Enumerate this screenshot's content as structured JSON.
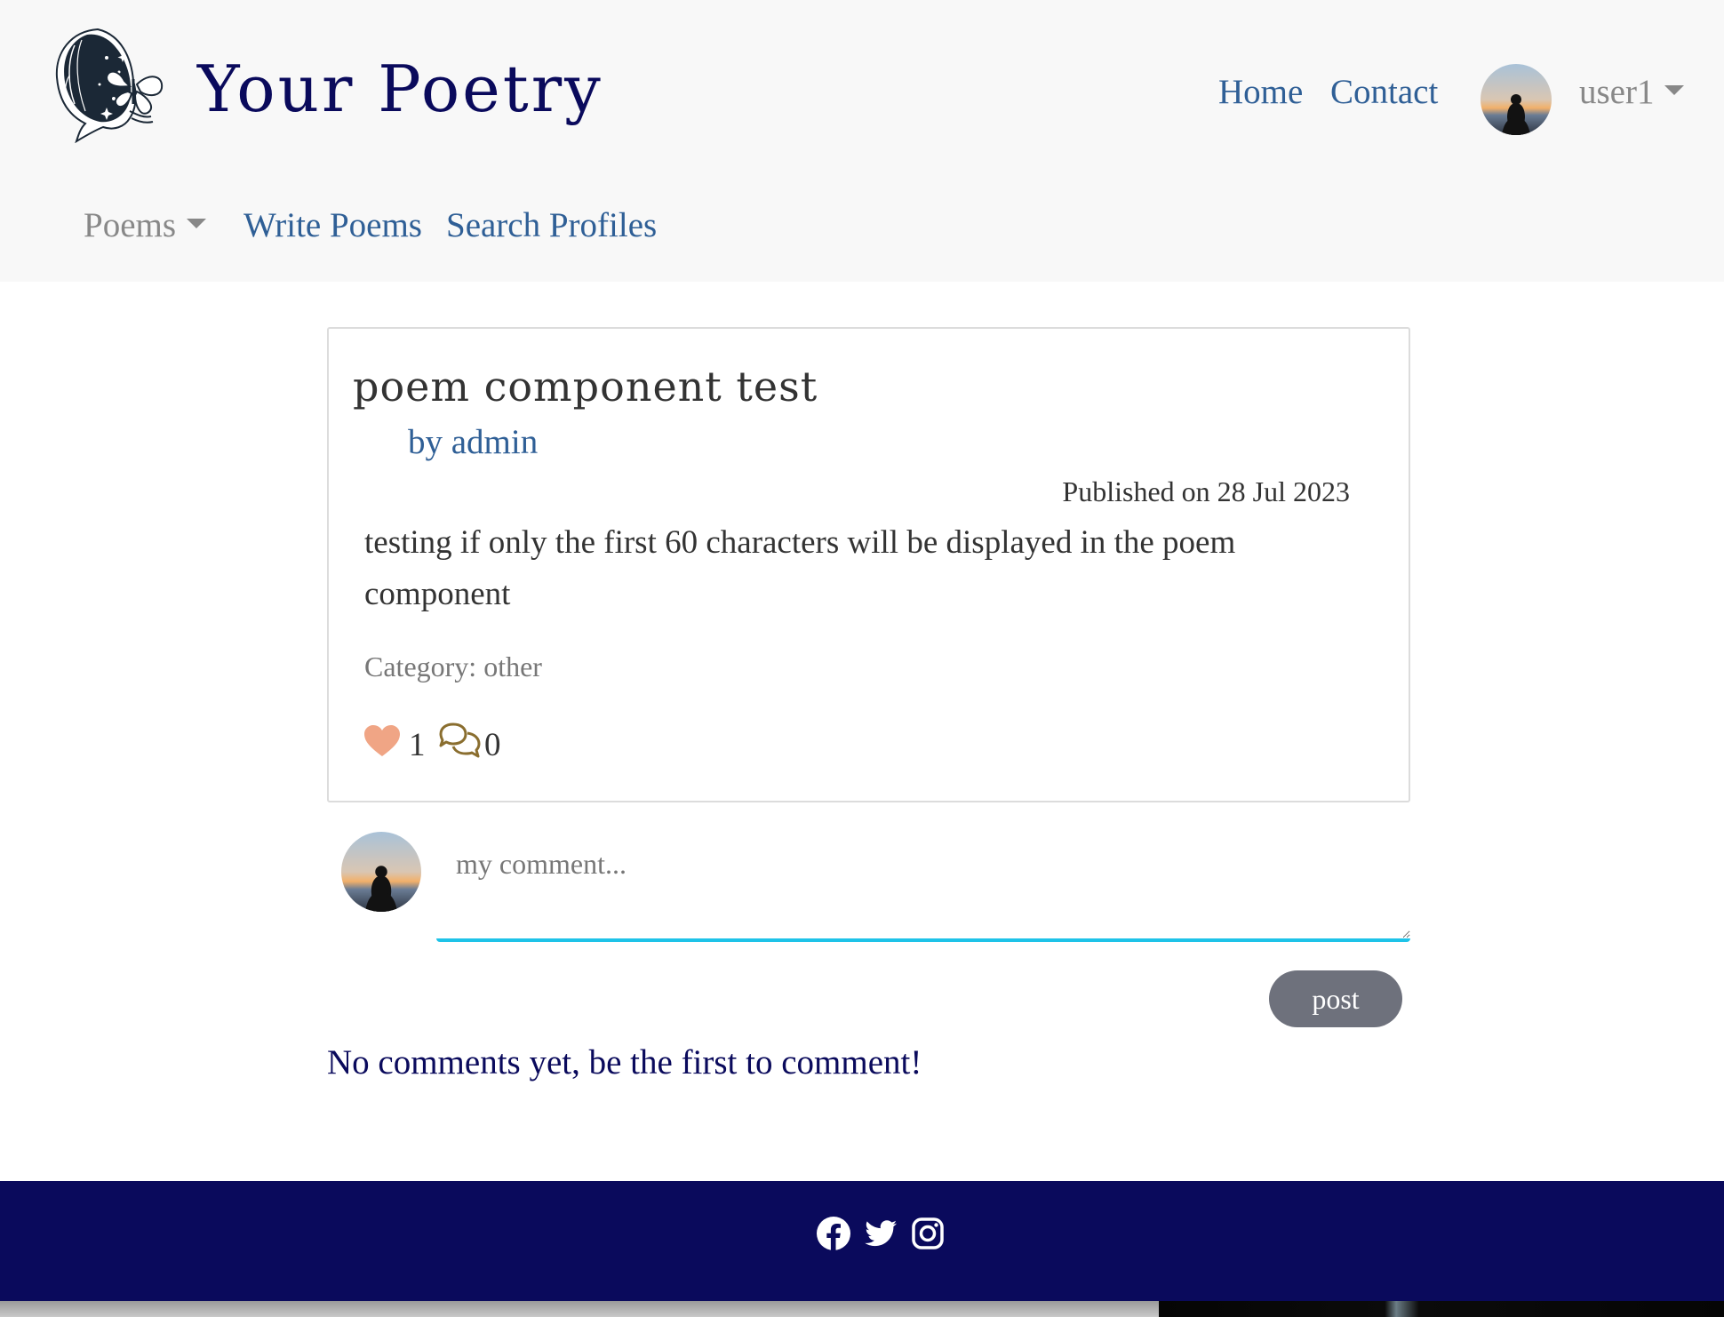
{
  "header": {
    "brand": "Your Poetry",
    "nav": {
      "home": "Home",
      "contact": "Contact"
    },
    "user": {
      "name": "user1"
    },
    "subnav": {
      "poems": "Poems",
      "write": "Write Poems",
      "search": "Search Profiles"
    }
  },
  "poem": {
    "title": "poem component test",
    "author": "by admin",
    "published": "Published on 28 Jul 2023",
    "body": "testing if only the first 60 characters will be displayed in the poem component",
    "category": "Category: other",
    "likes": "1",
    "comments": "0"
  },
  "comment_form": {
    "placeholder": "my comment...",
    "value": "",
    "post_label": "post"
  },
  "comments": {
    "empty_message": "No comments yet, be the first to comment!"
  },
  "footer": {
    "social": [
      "facebook-icon",
      "twitter-icon",
      "instagram-icon"
    ]
  },
  "colors": {
    "brand": "#0a0a5c",
    "link": "#2f5f96",
    "accent_input": "#1ec3e8",
    "like": "#f0a585",
    "comment_icon": "#8a6e2f",
    "button": "#6e717c",
    "footer_bg": "#0a0a5c"
  }
}
